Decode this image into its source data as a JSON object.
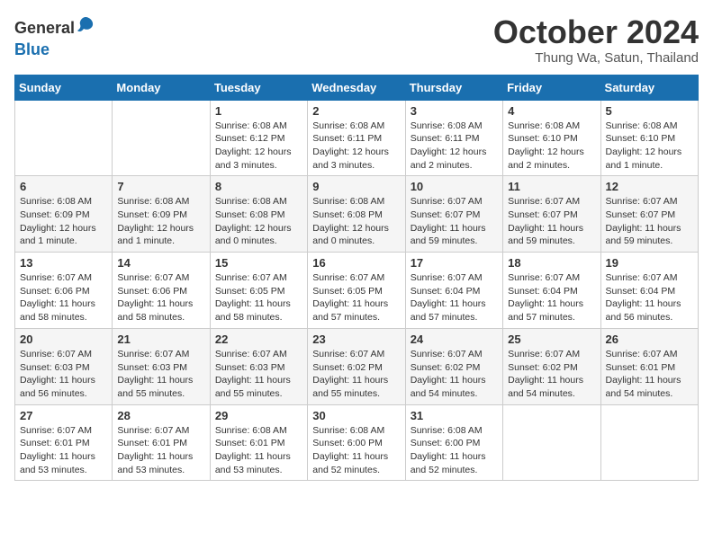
{
  "header": {
    "logo_general": "General",
    "logo_blue": "Blue",
    "month_title": "October 2024",
    "location": "Thung Wa, Satun, Thailand"
  },
  "days_of_week": [
    "Sunday",
    "Monday",
    "Tuesday",
    "Wednesday",
    "Thursday",
    "Friday",
    "Saturday"
  ],
  "weeks": [
    [
      {
        "day": "",
        "info": ""
      },
      {
        "day": "",
        "info": ""
      },
      {
        "day": "1",
        "info": "Sunrise: 6:08 AM\nSunset: 6:12 PM\nDaylight: 12 hours\nand 3 minutes."
      },
      {
        "day": "2",
        "info": "Sunrise: 6:08 AM\nSunset: 6:11 PM\nDaylight: 12 hours\nand 3 minutes."
      },
      {
        "day": "3",
        "info": "Sunrise: 6:08 AM\nSunset: 6:11 PM\nDaylight: 12 hours\nand 2 minutes."
      },
      {
        "day": "4",
        "info": "Sunrise: 6:08 AM\nSunset: 6:10 PM\nDaylight: 12 hours\nand 2 minutes."
      },
      {
        "day": "5",
        "info": "Sunrise: 6:08 AM\nSunset: 6:10 PM\nDaylight: 12 hours\nand 1 minute."
      }
    ],
    [
      {
        "day": "6",
        "info": "Sunrise: 6:08 AM\nSunset: 6:09 PM\nDaylight: 12 hours\nand 1 minute."
      },
      {
        "day": "7",
        "info": "Sunrise: 6:08 AM\nSunset: 6:09 PM\nDaylight: 12 hours\nand 1 minute."
      },
      {
        "day": "8",
        "info": "Sunrise: 6:08 AM\nSunset: 6:08 PM\nDaylight: 12 hours\nand 0 minutes."
      },
      {
        "day": "9",
        "info": "Sunrise: 6:08 AM\nSunset: 6:08 PM\nDaylight: 12 hours\nand 0 minutes."
      },
      {
        "day": "10",
        "info": "Sunrise: 6:07 AM\nSunset: 6:07 PM\nDaylight: 11 hours\nand 59 minutes."
      },
      {
        "day": "11",
        "info": "Sunrise: 6:07 AM\nSunset: 6:07 PM\nDaylight: 11 hours\nand 59 minutes."
      },
      {
        "day": "12",
        "info": "Sunrise: 6:07 AM\nSunset: 6:07 PM\nDaylight: 11 hours\nand 59 minutes."
      }
    ],
    [
      {
        "day": "13",
        "info": "Sunrise: 6:07 AM\nSunset: 6:06 PM\nDaylight: 11 hours\nand 58 minutes."
      },
      {
        "day": "14",
        "info": "Sunrise: 6:07 AM\nSunset: 6:06 PM\nDaylight: 11 hours\nand 58 minutes."
      },
      {
        "day": "15",
        "info": "Sunrise: 6:07 AM\nSunset: 6:05 PM\nDaylight: 11 hours\nand 58 minutes."
      },
      {
        "day": "16",
        "info": "Sunrise: 6:07 AM\nSunset: 6:05 PM\nDaylight: 11 hours\nand 57 minutes."
      },
      {
        "day": "17",
        "info": "Sunrise: 6:07 AM\nSunset: 6:04 PM\nDaylight: 11 hours\nand 57 minutes."
      },
      {
        "day": "18",
        "info": "Sunrise: 6:07 AM\nSunset: 6:04 PM\nDaylight: 11 hours\nand 57 minutes."
      },
      {
        "day": "19",
        "info": "Sunrise: 6:07 AM\nSunset: 6:04 PM\nDaylight: 11 hours\nand 56 minutes."
      }
    ],
    [
      {
        "day": "20",
        "info": "Sunrise: 6:07 AM\nSunset: 6:03 PM\nDaylight: 11 hours\nand 56 minutes."
      },
      {
        "day": "21",
        "info": "Sunrise: 6:07 AM\nSunset: 6:03 PM\nDaylight: 11 hours\nand 55 minutes."
      },
      {
        "day": "22",
        "info": "Sunrise: 6:07 AM\nSunset: 6:03 PM\nDaylight: 11 hours\nand 55 minutes."
      },
      {
        "day": "23",
        "info": "Sunrise: 6:07 AM\nSunset: 6:02 PM\nDaylight: 11 hours\nand 55 minutes."
      },
      {
        "day": "24",
        "info": "Sunrise: 6:07 AM\nSunset: 6:02 PM\nDaylight: 11 hours\nand 54 minutes."
      },
      {
        "day": "25",
        "info": "Sunrise: 6:07 AM\nSunset: 6:02 PM\nDaylight: 11 hours\nand 54 minutes."
      },
      {
        "day": "26",
        "info": "Sunrise: 6:07 AM\nSunset: 6:01 PM\nDaylight: 11 hours\nand 54 minutes."
      }
    ],
    [
      {
        "day": "27",
        "info": "Sunrise: 6:07 AM\nSunset: 6:01 PM\nDaylight: 11 hours\nand 53 minutes."
      },
      {
        "day": "28",
        "info": "Sunrise: 6:07 AM\nSunset: 6:01 PM\nDaylight: 11 hours\nand 53 minutes."
      },
      {
        "day": "29",
        "info": "Sunrise: 6:08 AM\nSunset: 6:01 PM\nDaylight: 11 hours\nand 53 minutes."
      },
      {
        "day": "30",
        "info": "Sunrise: 6:08 AM\nSunset: 6:00 PM\nDaylight: 11 hours\nand 52 minutes."
      },
      {
        "day": "31",
        "info": "Sunrise: 6:08 AM\nSunset: 6:00 PM\nDaylight: 11 hours\nand 52 minutes."
      },
      {
        "day": "",
        "info": ""
      },
      {
        "day": "",
        "info": ""
      }
    ]
  ]
}
